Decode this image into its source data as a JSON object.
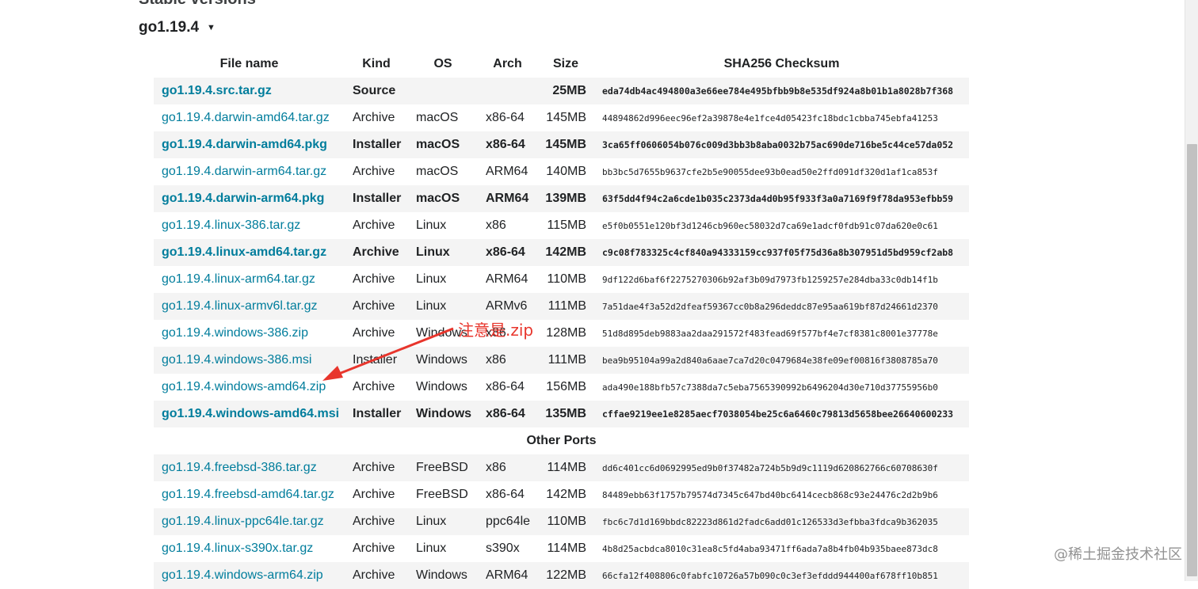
{
  "page": {
    "cut_heading": "Stable versions",
    "version_toggle": "go1.19.4",
    "caret": "▼"
  },
  "table": {
    "headers": [
      "File name",
      "Kind",
      "OS",
      "Arch",
      "Size",
      "SHA256 Checksum"
    ],
    "rows": [
      {
        "file": "go1.19.4.src.tar.gz",
        "kind": "Source",
        "os": "",
        "arch": "",
        "size": "25MB",
        "sha": "eda74db4ac494800a3e66ee784e495bfbb9b8e535df924a8b01b1a8028b7f368",
        "highlight": true
      },
      {
        "file": "go1.19.4.darwin-amd64.tar.gz",
        "kind": "Archive",
        "os": "macOS",
        "arch": "x86-64",
        "size": "145MB",
        "sha": "44894862d996eec96ef2a39878e4e1fce4d05423fc18bdc1cbba745ebfa41253",
        "highlight": false
      },
      {
        "file": "go1.19.4.darwin-amd64.pkg",
        "kind": "Installer",
        "os": "macOS",
        "arch": "x86-64",
        "size": "145MB",
        "sha": "3ca65ff0606054b076c009d3bb3b8aba0032b75ac690de716be5c44ce57da052",
        "highlight": true
      },
      {
        "file": "go1.19.4.darwin-arm64.tar.gz",
        "kind": "Archive",
        "os": "macOS",
        "arch": "ARM64",
        "size": "140MB",
        "sha": "bb3bc5d7655b9637cfe2b5e90055dee93b0ead50e2ffd091df320d1af1ca853f",
        "highlight": false
      },
      {
        "file": "go1.19.4.darwin-arm64.pkg",
        "kind": "Installer",
        "os": "macOS",
        "arch": "ARM64",
        "size": "139MB",
        "sha": "63f5dd4f94c2a6cde1b035c2373da4d0b95f933f3a0a7169f9f78da953efbb59",
        "highlight": true
      },
      {
        "file": "go1.19.4.linux-386.tar.gz",
        "kind": "Archive",
        "os": "Linux",
        "arch": "x86",
        "size": "115MB",
        "sha": "e5f0b0551e120bf3d1246cb960ec58032d7ca69e1adcf0fdb91c07da620e0c61",
        "highlight": false
      },
      {
        "file": "go1.19.4.linux-amd64.tar.gz",
        "kind": "Archive",
        "os": "Linux",
        "arch": "x86-64",
        "size": "142MB",
        "sha": "c9c08f783325c4cf840a94333159cc937f05f75d36a8b307951d5bd959cf2ab8",
        "highlight": true
      },
      {
        "file": "go1.19.4.linux-arm64.tar.gz",
        "kind": "Archive",
        "os": "Linux",
        "arch": "ARM64",
        "size": "110MB",
        "sha": "9df122d6baf6f2275270306b92af3b09d7973fb1259257e284dba33c0db14f1b",
        "highlight": false
      },
      {
        "file": "go1.19.4.linux-armv6l.tar.gz",
        "kind": "Archive",
        "os": "Linux",
        "arch": "ARMv6",
        "size": "111MB",
        "sha": "7a51dae4f3a52d2dfeaf59367cc0b8a296deddc87e95aa619bf87d24661d2370",
        "highlight": false
      },
      {
        "file": "go1.19.4.windows-386.zip",
        "kind": "Archive",
        "os": "Windows",
        "arch": "x86",
        "size": "128MB",
        "sha": "51d8d895deb9883aa2daa291572f483fead69f577bf4e7cf8381c8001e37778e",
        "highlight": false
      },
      {
        "file": "go1.19.4.windows-386.msi",
        "kind": "Installer",
        "os": "Windows",
        "arch": "x86",
        "size": "111MB",
        "sha": "bea9b95104a99a2d840a6aae7ca7d20c0479684e38fe09ef00816f3808785a70",
        "highlight": false
      },
      {
        "file": "go1.19.4.windows-amd64.zip",
        "kind": "Archive",
        "os": "Windows",
        "arch": "x86-64",
        "size": "156MB",
        "sha": "ada490e188bfb57c7388da7c5eba7565390992b6496204d30e710d37755956b0",
        "highlight": false
      },
      {
        "file": "go1.19.4.windows-amd64.msi",
        "kind": "Installer",
        "os": "Windows",
        "arch": "x86-64",
        "size": "135MB",
        "sha": "cffae9219ee1e8285aecf7038054be25c6a6460c79813d5658bee26640600233",
        "highlight": true
      }
    ],
    "other_ports_label": "Other Ports",
    "other_rows": [
      {
        "file": "go1.19.4.freebsd-386.tar.gz",
        "kind": "Archive",
        "os": "FreeBSD",
        "arch": "x86",
        "size": "114MB",
        "sha": "dd6c401cc6d0692995ed9b0f37482a724b5b9d9c1119d620862766c60708630f"
      },
      {
        "file": "go1.19.4.freebsd-amd64.tar.gz",
        "kind": "Archive",
        "os": "FreeBSD",
        "arch": "x86-64",
        "size": "142MB",
        "sha": "84489ebb63f1757b79574d7345c647bd40bc6414cecb868c93e24476c2d2b9b6"
      },
      {
        "file": "go1.19.4.linux-ppc64le.tar.gz",
        "kind": "Archive",
        "os": "Linux",
        "arch": "ppc64le",
        "size": "110MB",
        "sha": "fbc6c7d1d169bbdc82223d861d2fadc6add01c126533d3efbba3fdca9b362035"
      },
      {
        "file": "go1.19.4.linux-s390x.tar.gz",
        "kind": "Archive",
        "os": "Linux",
        "arch": "s390x",
        "size": "114MB",
        "sha": "4b8d25acbdca8010c31ea8c5fd4aba93471ff6ada7a8b4fb04b935baee873dc8"
      },
      {
        "file": "go1.19.4.windows-arm64.zip",
        "kind": "Archive",
        "os": "Windows",
        "arch": "ARM64",
        "size": "122MB",
        "sha": "66cfa12f408806c0fabfc10726a57b090c0c3ef3efddd944400af678ff10b851"
      }
    ]
  },
  "annotation": {
    "text": "注意是.zip",
    "color": "#e8352c"
  },
  "watermark": "@稀土掘金技术社区",
  "colors": {
    "link": "#007d9c",
    "stripe": "#f4f4f4"
  }
}
